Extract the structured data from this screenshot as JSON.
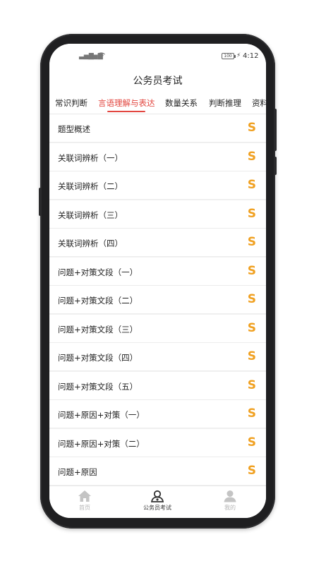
{
  "status_bar": {
    "signal_1": "▃▅▇",
    "signal_2": "▃▅▇",
    "battery": "100",
    "time": "4:12"
  },
  "header": {
    "title": "公务员考试"
  },
  "tabs": [
    {
      "label": "常识判断",
      "active": false
    },
    {
      "label": "言语理解与表达",
      "active": true
    },
    {
      "label": "数量关系",
      "active": false
    },
    {
      "label": "判断推理",
      "active": false
    },
    {
      "label": "资料",
      "active": false
    }
  ],
  "list": {
    "coin_symbol": "S",
    "items": [
      "题型概述",
      "关联词辨析（一）",
      "关联词辨析（二）",
      "关联词辨析（三）",
      "关联词辨析（四）",
      "问题+对策文段（一）",
      "问题+对策文段（二）",
      "问题+对策文段（三）",
      "问题+对策文段（四）",
      "问题+对策文段（五）",
      "问题+原因+对策（一）",
      "问题+原因+对策（二）",
      "问题+原因"
    ]
  },
  "bottom_nav": [
    {
      "label": "首页",
      "icon": "home-icon",
      "active": false
    },
    {
      "label": "公务员考试",
      "icon": "exam-user-icon",
      "active": true
    },
    {
      "label": "我的",
      "icon": "person-icon",
      "active": false
    }
  ],
  "colors": {
    "accent": "#e2463f",
    "coin": "#f0a020"
  }
}
